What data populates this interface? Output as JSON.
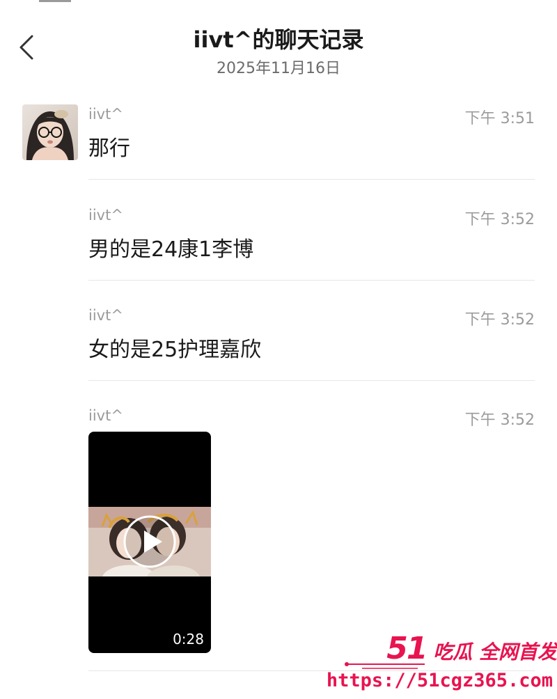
{
  "header": {
    "title": "iivt^的聊天记录",
    "date": "2025年11月16日",
    "back_icon": "chevron-left-icon"
  },
  "messages": [
    {
      "sender": "iivt^",
      "time": "下午 3:51",
      "text": "那行"
    },
    {
      "sender": "iivt^",
      "time": "下午 3:52",
      "text": "男的是24康1李博"
    },
    {
      "sender": "iivt^",
      "time": "下午 3:52",
      "text": "女的是25护理嘉欣"
    },
    {
      "sender": "iivt^",
      "time": "下午 3:52",
      "video": {
        "duration": "0:28",
        "icon": "play-icon"
      }
    }
  ],
  "watermark": {
    "brand_number": "51",
    "brand_text": "吃瓜 全网首发",
    "url": "https://51cgz365.com",
    "color": "#e8134f"
  }
}
